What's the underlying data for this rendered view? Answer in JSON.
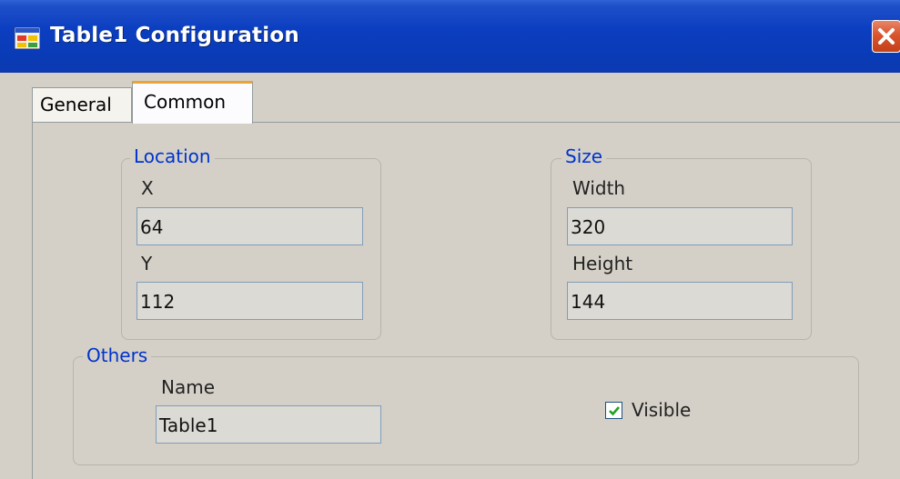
{
  "window": {
    "title": "Table1 Configuration"
  },
  "tabs": [
    {
      "label": "General",
      "active": false
    },
    {
      "label": "Common",
      "active": true
    }
  ],
  "location": {
    "title": "Location",
    "x_label": "X",
    "x_value": "64",
    "y_label": "Y",
    "y_value": "112"
  },
  "size": {
    "title": "Size",
    "width_label": "Width",
    "width_value": "320",
    "height_label": "Height",
    "height_value": "144"
  },
  "others": {
    "title": "Others",
    "name_label": "Name",
    "name_value": "Table1",
    "visible_label": "Visible",
    "visible_checked": true
  },
  "icons": {
    "app": "app-window-icon",
    "close": "close-icon",
    "check": "check-icon"
  },
  "colors": {
    "titlebar": "#0b3ec0",
    "group_title": "#0033cc",
    "close_button": "#d8552d",
    "tab_highlight": "#e6a43a"
  }
}
